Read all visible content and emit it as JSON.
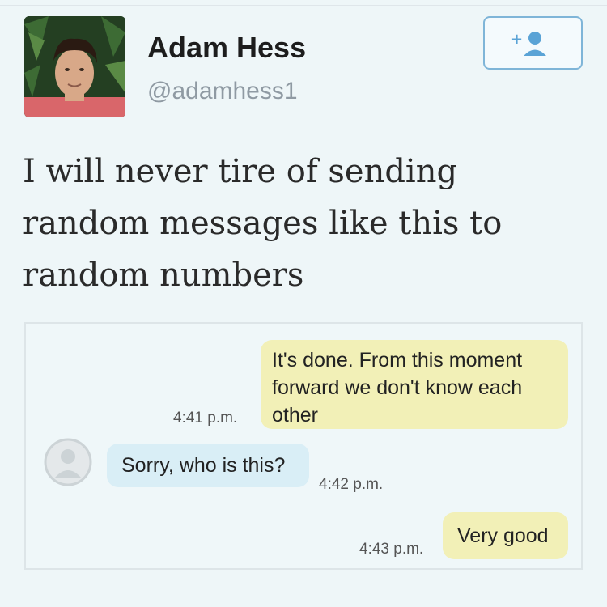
{
  "author": {
    "name": "Adam Hess",
    "handle": "@adamhess1"
  },
  "follow_button": {
    "icon": "add-user-icon",
    "color": "#7fb5d8"
  },
  "tweet": {
    "lines": [
      "I will never tire of sending",
      "random messages like this to",
      "random numbers"
    ]
  },
  "conversation": {
    "messages": [
      {
        "direction": "outgoing",
        "lines": [
          "It's done. From this moment",
          "forward we don't know each",
          "other"
        ],
        "time": "4:41 p.m."
      },
      {
        "direction": "incoming",
        "lines": [
          "Sorry, who is this?"
        ],
        "time": "4:42 p.m."
      },
      {
        "direction": "outgoing",
        "lines": [
          "Very good"
        ],
        "time": "4:43 p.m."
      }
    ],
    "colors": {
      "outgoing": "#f2f0b7",
      "incoming": "#d9eef6"
    }
  }
}
